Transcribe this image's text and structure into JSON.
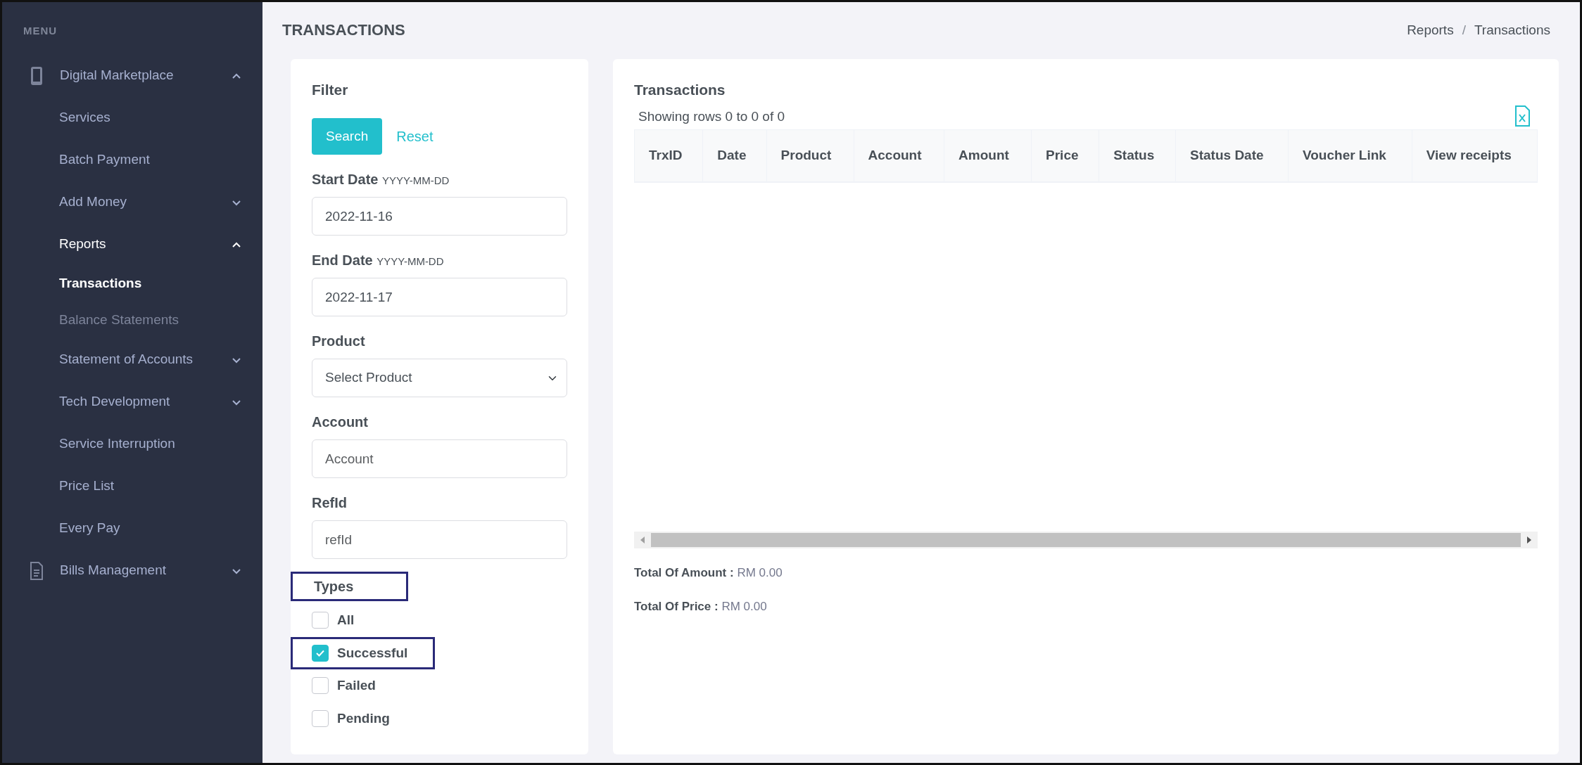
{
  "sidebar": {
    "heading": "MENU",
    "items": [
      {
        "label": "Digital Marketplace",
        "expanded": true,
        "children": [
          {
            "label": "Services",
            "selected": false
          },
          {
            "label": "Batch Payment",
            "selected": false
          },
          {
            "label": "Add Money",
            "expanded": false,
            "selected": false
          },
          {
            "label": "Reports",
            "expanded": true,
            "children": [
              {
                "label": "Transactions",
                "selected": true
              },
              {
                "label": "Balance Statements",
                "selected": false
              }
            ]
          },
          {
            "label": "Statement of Accounts",
            "expanded": false,
            "selected": false
          },
          {
            "label": "Tech Development",
            "expanded": false,
            "selected": false
          },
          {
            "label": "Service Interruption",
            "selected": false
          },
          {
            "label": "Price List",
            "selected": false
          },
          {
            "label": "Every Pay",
            "selected": false
          }
        ]
      },
      {
        "label": "Bills Management",
        "expanded": false
      }
    ]
  },
  "page_title": "TRANSACTIONS",
  "breadcrumb": {
    "separator": "/",
    "items": [
      "Reports",
      "Transactions"
    ]
  },
  "filter": {
    "title": "Filter",
    "buttons": [
      {
        "label": "Search",
        "kind": "primary"
      },
      {
        "label": "Reset",
        "kind": "link"
      }
    ],
    "fields": [
      {
        "label": "Start Date",
        "hint": "YYYY-MM-DD",
        "kind": "input",
        "value": "2022-11-16"
      },
      {
        "label": "End Date",
        "hint": "YYYY-MM-DD",
        "kind": "input",
        "value": "2022-11-17"
      },
      {
        "label": "Product",
        "kind": "select",
        "value": "Select Product"
      },
      {
        "label": "Account",
        "kind": "input",
        "placeholder": "Account"
      },
      {
        "label": "RefId",
        "kind": "input",
        "placeholder": "refId"
      }
    ],
    "types": {
      "label": "Types",
      "highlighted": true,
      "options": [
        {
          "label": "All",
          "checked": false,
          "highlighted": false
        },
        {
          "label": "Successful",
          "checked": true,
          "highlighted": true
        },
        {
          "label": "Failed",
          "checked": false,
          "highlighted": false
        },
        {
          "label": "Pending",
          "checked": false,
          "highlighted": false
        }
      ]
    }
  },
  "table_card": {
    "title": "Transactions",
    "summary": "Showing rows 0 to 0 of 0",
    "columns": [
      "TrxID",
      "Date",
      "Product",
      "Account",
      "Amount",
      "Price",
      "Status",
      "Status Date",
      "Voucher Link",
      "View receipts"
    ],
    "totals": [
      {
        "label": "Total Of Amount :",
        "value": "RM 0.00"
      },
      {
        "label": "Total Of Price :",
        "value": "RM 0.00"
      }
    ]
  }
}
